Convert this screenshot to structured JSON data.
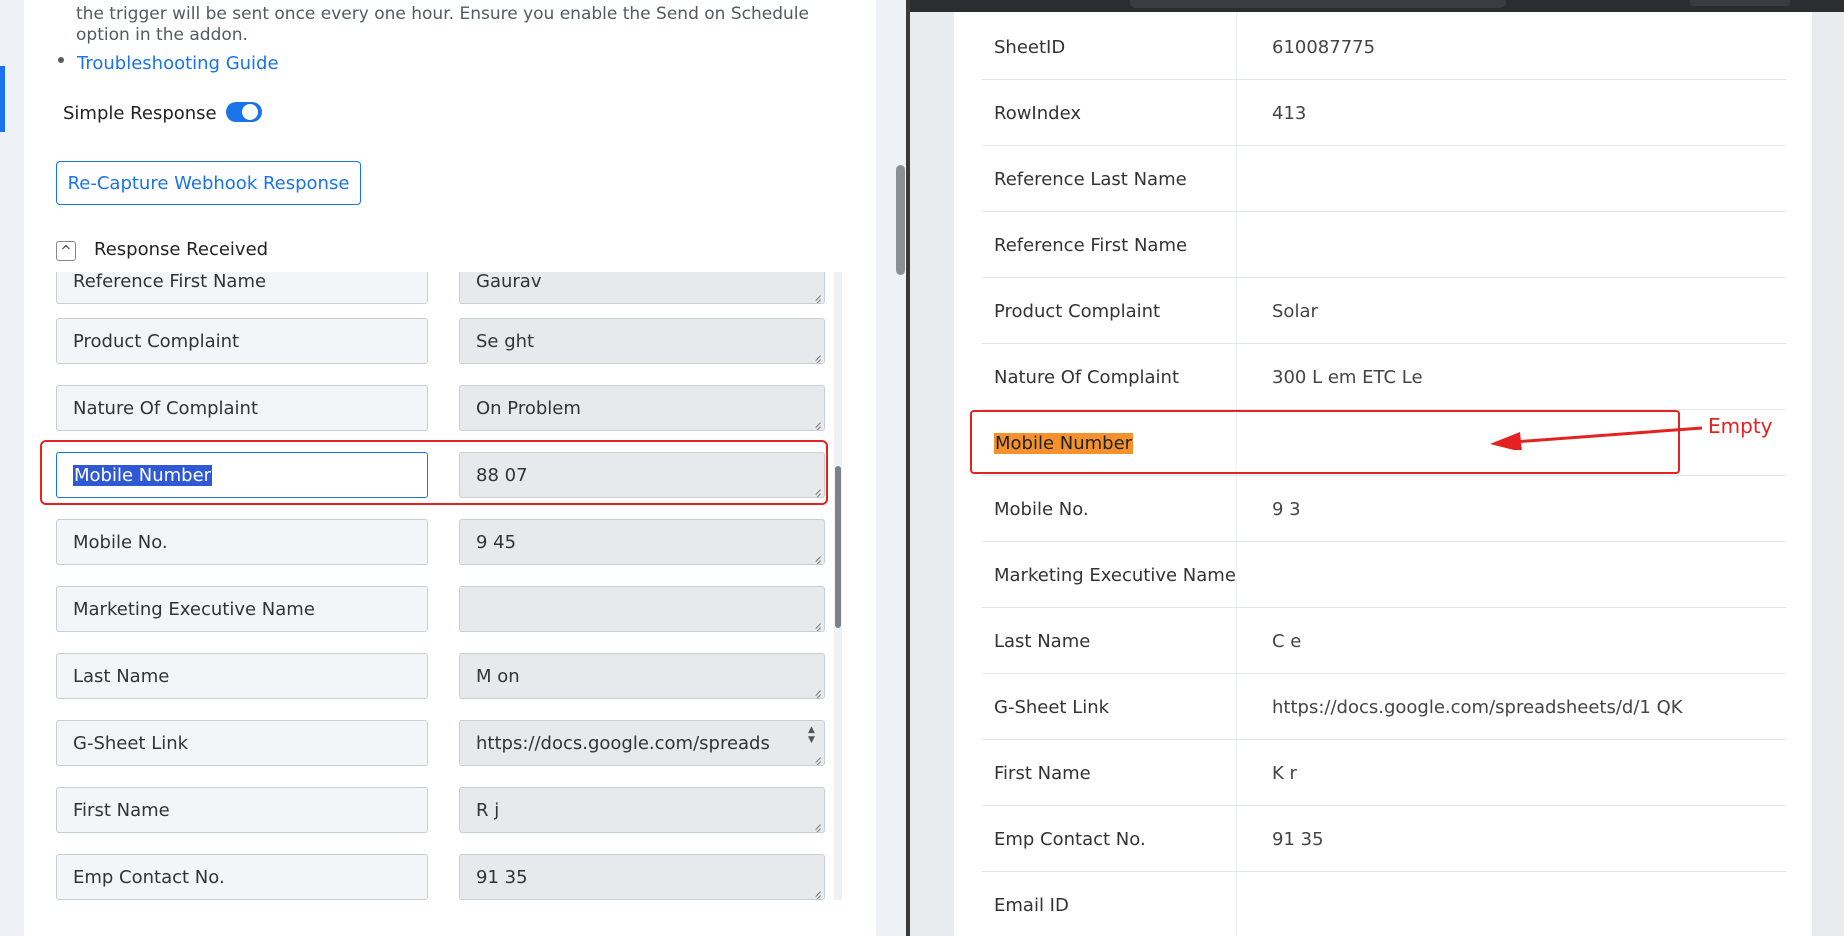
{
  "left": {
    "note": "the trigger will be sent once every one hour. Ensure you enable the Send on Schedule option in the addon.",
    "troubleshooting_link": "Troubleshooting Guide",
    "simple_response_label": "Simple Response",
    "simple_response_on": true,
    "recapture_button": "Re-Capture Webhook Response",
    "response_received_label": "Response Received",
    "collapse_glyph": "^",
    "rows": [
      {
        "label": "Reference First Name",
        "value": "Gaurav"
      },
      {
        "label": "Product Complaint",
        "value": "Se  ght"
      },
      {
        "label": "Nature Of Complaint",
        "value": "On  Problem"
      },
      {
        "label": "Mobile Number",
        "value": "88  07"
      },
      {
        "label": "Mobile No.",
        "value": "9  45"
      },
      {
        "label": "Marketing Executive Name",
        "value": ""
      },
      {
        "label": "Last Name",
        "value": "M  on"
      },
      {
        "label": "G-Sheet Link",
        "value": "https://docs.google.com/spreads"
      },
      {
        "label": "First Name",
        "value": "R  j"
      },
      {
        "label": "Emp Contact No.",
        "value": "91  35"
      }
    ]
  },
  "right": {
    "rows": [
      {
        "key": "SheetID",
        "value": "610087775"
      },
      {
        "key": "RowIndex",
        "value": "413"
      },
      {
        "key": "Reference Last Name",
        "value": ""
      },
      {
        "key": "Reference First Name",
        "value": ""
      },
      {
        "key": "Product Complaint",
        "value": "Solar"
      },
      {
        "key": "Nature Of Complaint",
        "value": "300 L  em ETC Le"
      },
      {
        "key": "Mobile Number",
        "value": ""
      },
      {
        "key": "Mobile No.",
        "value": "9  3"
      },
      {
        "key": "Marketing Executive Name",
        "value": ""
      },
      {
        "key": "Last Name",
        "value": "C  e"
      },
      {
        "key": "G-Sheet Link",
        "value": "https://docs.google.com/spreadsheets/d/1  QK"
      },
      {
        "key": "First Name",
        "value": "K  r"
      },
      {
        "key": "Emp Contact No.",
        "value": "91  35"
      },
      {
        "key": "Email ID",
        "value": ""
      }
    ],
    "annotation": "Empty"
  },
  "colors": {
    "accent": "#1a73e8",
    "annotation_red": "#e52222",
    "highlight_orange": "#f5922e"
  }
}
